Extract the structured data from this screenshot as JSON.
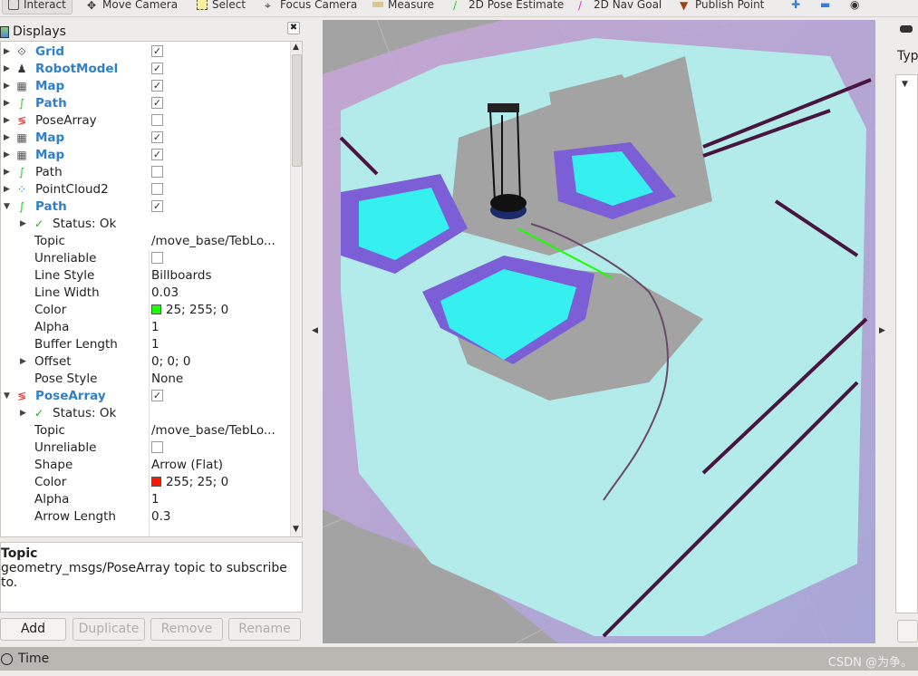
{
  "toolbar": {
    "tools": [
      {
        "label": "Interact",
        "icon": "interact-icon"
      },
      {
        "label": "Move Camera",
        "icon": "move-camera-icon"
      },
      {
        "label": "Select",
        "icon": "select-icon"
      },
      {
        "label": "Focus Camera",
        "icon": "focus-camera-icon"
      },
      {
        "label": "Measure",
        "icon": "measure-icon"
      },
      {
        "label": "2D Pose Estimate",
        "icon": "pose-estimate-icon"
      },
      {
        "label": "2D Nav Goal",
        "icon": "nav-goal-icon"
      },
      {
        "label": "Publish Point",
        "icon": "publish-point-icon"
      }
    ]
  },
  "displays": {
    "title": "Displays",
    "items": [
      {
        "label": "Grid",
        "checked": true,
        "bold": true,
        "icon": "grid-icon"
      },
      {
        "label": "RobotModel",
        "checked": true,
        "bold": true,
        "icon": "robot-icon"
      },
      {
        "label": "Map",
        "checked": true,
        "bold": true,
        "icon": "map-icon"
      },
      {
        "label": "Path",
        "checked": true,
        "bold": true,
        "icon": "path-icon"
      },
      {
        "label": "PoseArray",
        "checked": false,
        "bold": false,
        "icon": "posearray-icon"
      },
      {
        "label": "Map",
        "checked": true,
        "bold": true,
        "icon": "map-icon"
      },
      {
        "label": "Map",
        "checked": true,
        "bold": true,
        "icon": "map-icon"
      },
      {
        "label": "Path",
        "checked": false,
        "bold": false,
        "icon": "path-icon"
      },
      {
        "label": "PointCloud2",
        "checked": false,
        "bold": false,
        "icon": "pointcloud-icon"
      },
      {
        "label": "Path",
        "checked": true,
        "bold": true,
        "icon": "path-icon"
      }
    ],
    "path_props": {
      "status": "Status: Ok",
      "props": [
        {
          "k": "Topic",
          "v": "/move_base/TebLo..."
        },
        {
          "k": "Unreliable",
          "v": "",
          "cb": true
        },
        {
          "k": "Line Style",
          "v": "Billboards"
        },
        {
          "k": "Line Width",
          "v": "0.03"
        },
        {
          "k": "Color",
          "v": "25; 255; 0",
          "swatch": "#19ff00"
        },
        {
          "k": "Alpha",
          "v": "1"
        },
        {
          "k": "Buffer Length",
          "v": "1"
        },
        {
          "k": "Offset",
          "v": "0; 0; 0",
          "exp": true
        },
        {
          "k": "Pose Style",
          "v": "None"
        }
      ]
    },
    "posearray": {
      "label": "PoseArray",
      "checked": true,
      "status": "Status: Ok",
      "props": [
        {
          "k": "Topic",
          "v": "/move_base/TebLo..."
        },
        {
          "k": "Unreliable",
          "v": "",
          "cb": true
        },
        {
          "k": "Shape",
          "v": "Arrow (Flat)"
        },
        {
          "k": "Color",
          "v": "255; 25; 0",
          "swatch": "#ff1900"
        },
        {
          "k": "Alpha",
          "v": "1"
        },
        {
          "k": "Arrow Length",
          "v": "0.3"
        }
      ]
    }
  },
  "description": {
    "title": "Topic",
    "text": "geometry_msgs/PoseArray topic to subscribe to."
  },
  "buttons": {
    "add": "Add",
    "duplicate": "Duplicate",
    "remove": "Remove",
    "rename": "Rename"
  },
  "time": {
    "label": "Time"
  },
  "right_panel": {
    "type_label": "Typ"
  },
  "watermark": "CSDN @为争。"
}
